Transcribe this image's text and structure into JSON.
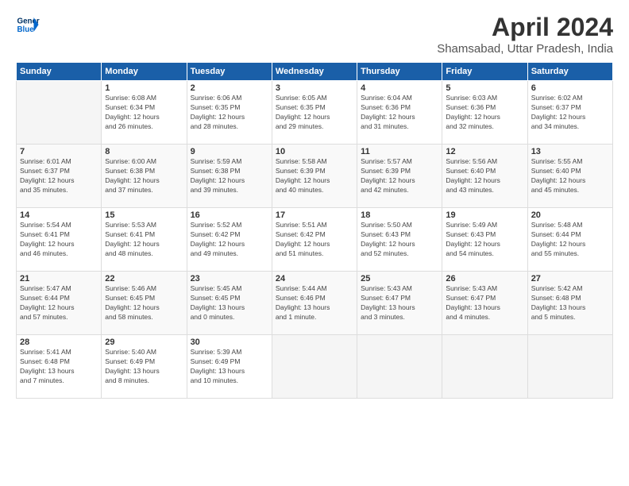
{
  "logo": {
    "line1": "General",
    "line2": "Blue"
  },
  "title": "April 2024",
  "subtitle": "Shamsabad, Uttar Pradesh, India",
  "days_of_week": [
    "Sunday",
    "Monday",
    "Tuesday",
    "Wednesday",
    "Thursday",
    "Friday",
    "Saturday"
  ],
  "weeks": [
    [
      {
        "day": "",
        "info": ""
      },
      {
        "day": "1",
        "info": "Sunrise: 6:08 AM\nSunset: 6:34 PM\nDaylight: 12 hours\nand 26 minutes."
      },
      {
        "day": "2",
        "info": "Sunrise: 6:06 AM\nSunset: 6:35 PM\nDaylight: 12 hours\nand 28 minutes."
      },
      {
        "day": "3",
        "info": "Sunrise: 6:05 AM\nSunset: 6:35 PM\nDaylight: 12 hours\nand 29 minutes."
      },
      {
        "day": "4",
        "info": "Sunrise: 6:04 AM\nSunset: 6:36 PM\nDaylight: 12 hours\nand 31 minutes."
      },
      {
        "day": "5",
        "info": "Sunrise: 6:03 AM\nSunset: 6:36 PM\nDaylight: 12 hours\nand 32 minutes."
      },
      {
        "day": "6",
        "info": "Sunrise: 6:02 AM\nSunset: 6:37 PM\nDaylight: 12 hours\nand 34 minutes."
      }
    ],
    [
      {
        "day": "7",
        "info": "Sunrise: 6:01 AM\nSunset: 6:37 PM\nDaylight: 12 hours\nand 35 minutes."
      },
      {
        "day": "8",
        "info": "Sunrise: 6:00 AM\nSunset: 6:38 PM\nDaylight: 12 hours\nand 37 minutes."
      },
      {
        "day": "9",
        "info": "Sunrise: 5:59 AM\nSunset: 6:38 PM\nDaylight: 12 hours\nand 39 minutes."
      },
      {
        "day": "10",
        "info": "Sunrise: 5:58 AM\nSunset: 6:39 PM\nDaylight: 12 hours\nand 40 minutes."
      },
      {
        "day": "11",
        "info": "Sunrise: 5:57 AM\nSunset: 6:39 PM\nDaylight: 12 hours\nand 42 minutes."
      },
      {
        "day": "12",
        "info": "Sunrise: 5:56 AM\nSunset: 6:40 PM\nDaylight: 12 hours\nand 43 minutes."
      },
      {
        "day": "13",
        "info": "Sunrise: 5:55 AM\nSunset: 6:40 PM\nDaylight: 12 hours\nand 45 minutes."
      }
    ],
    [
      {
        "day": "14",
        "info": "Sunrise: 5:54 AM\nSunset: 6:41 PM\nDaylight: 12 hours\nand 46 minutes."
      },
      {
        "day": "15",
        "info": "Sunrise: 5:53 AM\nSunset: 6:41 PM\nDaylight: 12 hours\nand 48 minutes."
      },
      {
        "day": "16",
        "info": "Sunrise: 5:52 AM\nSunset: 6:42 PM\nDaylight: 12 hours\nand 49 minutes."
      },
      {
        "day": "17",
        "info": "Sunrise: 5:51 AM\nSunset: 6:42 PM\nDaylight: 12 hours\nand 51 minutes."
      },
      {
        "day": "18",
        "info": "Sunrise: 5:50 AM\nSunset: 6:43 PM\nDaylight: 12 hours\nand 52 minutes."
      },
      {
        "day": "19",
        "info": "Sunrise: 5:49 AM\nSunset: 6:43 PM\nDaylight: 12 hours\nand 54 minutes."
      },
      {
        "day": "20",
        "info": "Sunrise: 5:48 AM\nSunset: 6:44 PM\nDaylight: 12 hours\nand 55 minutes."
      }
    ],
    [
      {
        "day": "21",
        "info": "Sunrise: 5:47 AM\nSunset: 6:44 PM\nDaylight: 12 hours\nand 57 minutes."
      },
      {
        "day": "22",
        "info": "Sunrise: 5:46 AM\nSunset: 6:45 PM\nDaylight: 12 hours\nand 58 minutes."
      },
      {
        "day": "23",
        "info": "Sunrise: 5:45 AM\nSunset: 6:45 PM\nDaylight: 13 hours\nand 0 minutes."
      },
      {
        "day": "24",
        "info": "Sunrise: 5:44 AM\nSunset: 6:46 PM\nDaylight: 13 hours\nand 1 minute."
      },
      {
        "day": "25",
        "info": "Sunrise: 5:43 AM\nSunset: 6:47 PM\nDaylight: 13 hours\nand 3 minutes."
      },
      {
        "day": "26",
        "info": "Sunrise: 5:43 AM\nSunset: 6:47 PM\nDaylight: 13 hours\nand 4 minutes."
      },
      {
        "day": "27",
        "info": "Sunrise: 5:42 AM\nSunset: 6:48 PM\nDaylight: 13 hours\nand 5 minutes."
      }
    ],
    [
      {
        "day": "28",
        "info": "Sunrise: 5:41 AM\nSunset: 6:48 PM\nDaylight: 13 hours\nand 7 minutes."
      },
      {
        "day": "29",
        "info": "Sunrise: 5:40 AM\nSunset: 6:49 PM\nDaylight: 13 hours\nand 8 minutes."
      },
      {
        "day": "30",
        "info": "Sunrise: 5:39 AM\nSunset: 6:49 PM\nDaylight: 13 hours\nand 10 minutes."
      },
      {
        "day": "",
        "info": ""
      },
      {
        "day": "",
        "info": ""
      },
      {
        "day": "",
        "info": ""
      },
      {
        "day": "",
        "info": ""
      }
    ]
  ]
}
